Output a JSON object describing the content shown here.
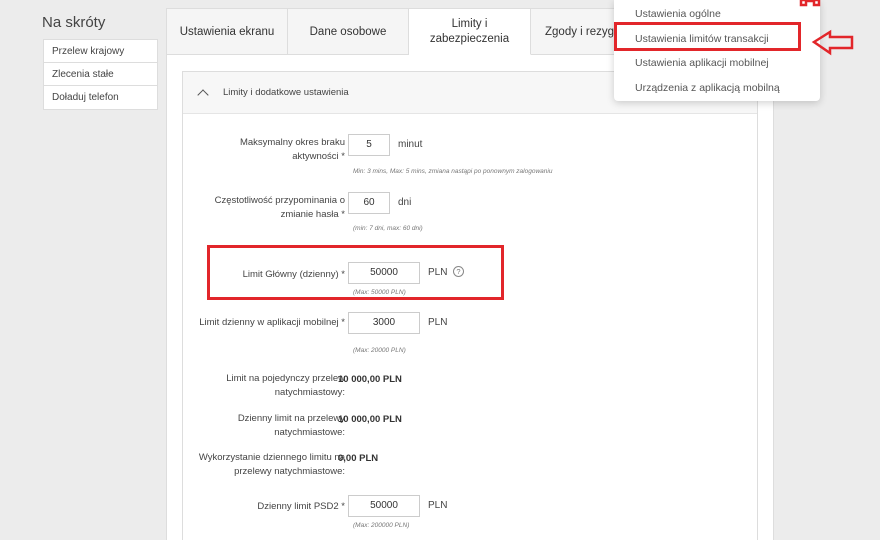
{
  "sidebar": {
    "title": "Na skróty",
    "items": [
      "Przelew krajowy",
      "Zlecenia stałe",
      "Doładuj telefon"
    ]
  },
  "tabs": {
    "screen": "Ustawienia ekranu",
    "personal": "Dane osobowe",
    "limits": "Limity i zabezpieczenia",
    "consents": "Zgody i rezygn"
  },
  "section": {
    "title": "Limity i dodatkowe ustawienia"
  },
  "fields": {
    "inactivity": {
      "label": "Maksymalny okres braku aktywności",
      "value": "5",
      "unit": "minut",
      "hint": "Min: 3 mins, Max: 5 mins, zmiana nastąpi po ponownym zalogowaniu"
    },
    "password": {
      "label": "Częstotliwość przypominania o zmianie hasła",
      "value": "60",
      "unit": "dni",
      "hint": "(min: 7 dni, max: 60 dni)"
    },
    "main_limit": {
      "label": "Limit Główny (dzienny)",
      "value": "50000",
      "unit": "PLN",
      "hint": "(Max: 50000 PLN)"
    },
    "mobile_limit": {
      "label": "Limit dzienny w aplikacji mobilnej",
      "value": "3000",
      "unit": "PLN",
      "hint": "(Max: 20000 PLN)"
    },
    "single_instant": {
      "label": "Limit na pojedynczy przelew natychmiastowy:",
      "value": "10 000,00 PLN"
    },
    "daily_instant": {
      "label": "Dzienny limit na przelewy natychmiastowe:",
      "value": "10 000,00 PLN"
    },
    "used_instant": {
      "label": "Wykorzystanie dziennego limitu na przelewy natychmiastowe:",
      "value": "0,00 PLN"
    },
    "psd2": {
      "label": "Dzienny limit PSD2",
      "value": "50000",
      "unit": "PLN",
      "hint": "(Max: 200000 PLN)"
    },
    "required_mark": "*",
    "help_glyph": "?"
  },
  "dropdown": {
    "items": [
      "Ustawienia ogólne",
      "Ustawienia limitów transakcji",
      "Ustawienia aplikacji mobilnej",
      "Urządzenia z aplikacją mobilną"
    ]
  },
  "colors": {
    "highlight": "#e2262a"
  }
}
